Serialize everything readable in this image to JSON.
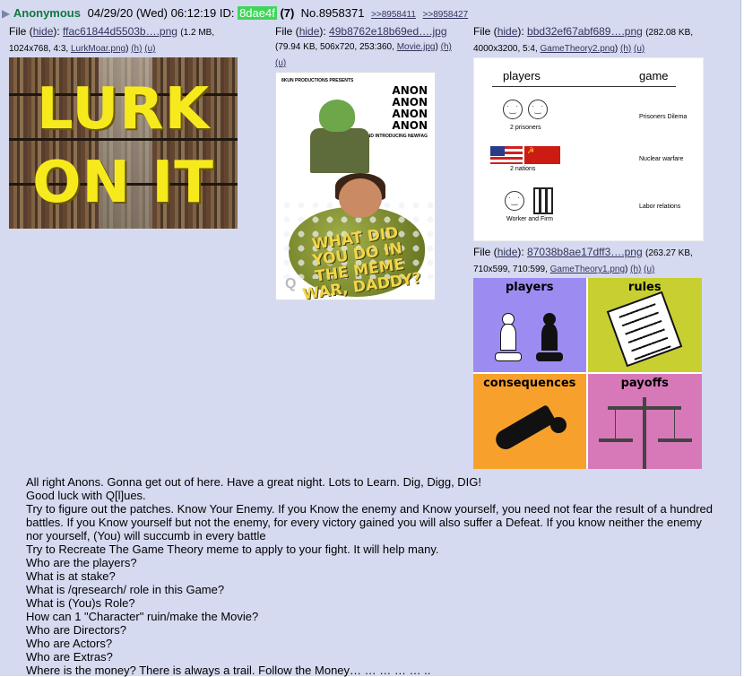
{
  "intro": {
    "name": "Anonymous",
    "date": "04/29/20 (Wed) 06:12:19",
    "id_label": "ID:",
    "id_value": "8dae4f",
    "post_count": "(7)",
    "post_no": "No.8958371",
    "backlinks": [
      ">>8958411",
      ">>8958427"
    ]
  },
  "files": [
    {
      "label": "File",
      "hide": "hide",
      "name": "ffac61844d5503b….png",
      "size": "1.2 MB",
      "dims": "1024x768, 4:3,",
      "orig": "LurkMoar.png",
      "h": "(h)",
      "u": "(u)",
      "thumb_text": [
        "LURK",
        "ON IT"
      ]
    },
    {
      "label": "File",
      "hide": "hide",
      "name": "49b8762e18b69ed….jpg",
      "size": "79.94 KB, 506x720, 253:360,",
      "orig": "Movie.jpg",
      "h": "(h)",
      "u": "(u)",
      "poster": {
        "producer": "8KUN PRODUCTIONS PRESENTS",
        "anon_lines": [
          "ANON",
          "ANON",
          "ANON",
          "ANON"
        ],
        "introducing": "AND INTRODUCING NEWFAG",
        "title": "WHAT DID YOU DO IN THE MEME WAR, DADDY?",
        "corner": "Q"
      }
    },
    {
      "label": "File",
      "hide": "hide",
      "name": "bbd32ef67abf689….png",
      "size": "282.08 KB,",
      "dims": "4000x3200, 5:4,",
      "orig": "GameTheory2.png",
      "h": "(h)",
      "u": "(u)",
      "diagram": {
        "col_players": "players",
        "col_game": "game",
        "rows": [
          {
            "caption": "2 prisoners",
            "game": "Prisoners Dilema"
          },
          {
            "caption": "2 nations",
            "game": "Nuclear warfare"
          },
          {
            "caption": "Worker and Firm",
            "game": "Labor relations"
          }
        ]
      }
    },
    {
      "label": "File",
      "hide": "hide",
      "name": "87038b8ae17dff3….png",
      "size": "263.27 KB,",
      "dims": "710x599, 710:599,",
      "orig": "GameTheory1.png",
      "h": "(h)",
      "u": "(u)",
      "quadrants": [
        "players",
        "rules",
        "consequences",
        "payoffs"
      ]
    }
  ],
  "body": [
    "All right Anons. Gonna get out of here. Have a great night. Lots to Learn. Dig, Digg, DIG!",
    "Good luck with Q[l]ues.",
    "Try to figure out the patches. Know Your Enemy. If you Know the enemy and Know yourself, you need not fear the result of a hundred battles. If you Know yourself but not the enemy, for every victory gained you will also suffer a Defeat. If you know neither the enemy nor yourself, (You) will succumb in every battle",
    "Try to Recreate The Game Theory meme to apply to your fight. It will help many.",
    "Who are the players?",
    "What is at stake?",
    "What is /qresearch/ role in this Game?",
    "What is (You)s Role?",
    "How can 1 \"Character\" ruin/make the Movie?",
    "Who are Directors?",
    "Who are Actors?",
    "Who are Extras?",
    "Where is the money? There is always a trail. Follow the Money… … … … … .."
  ]
}
